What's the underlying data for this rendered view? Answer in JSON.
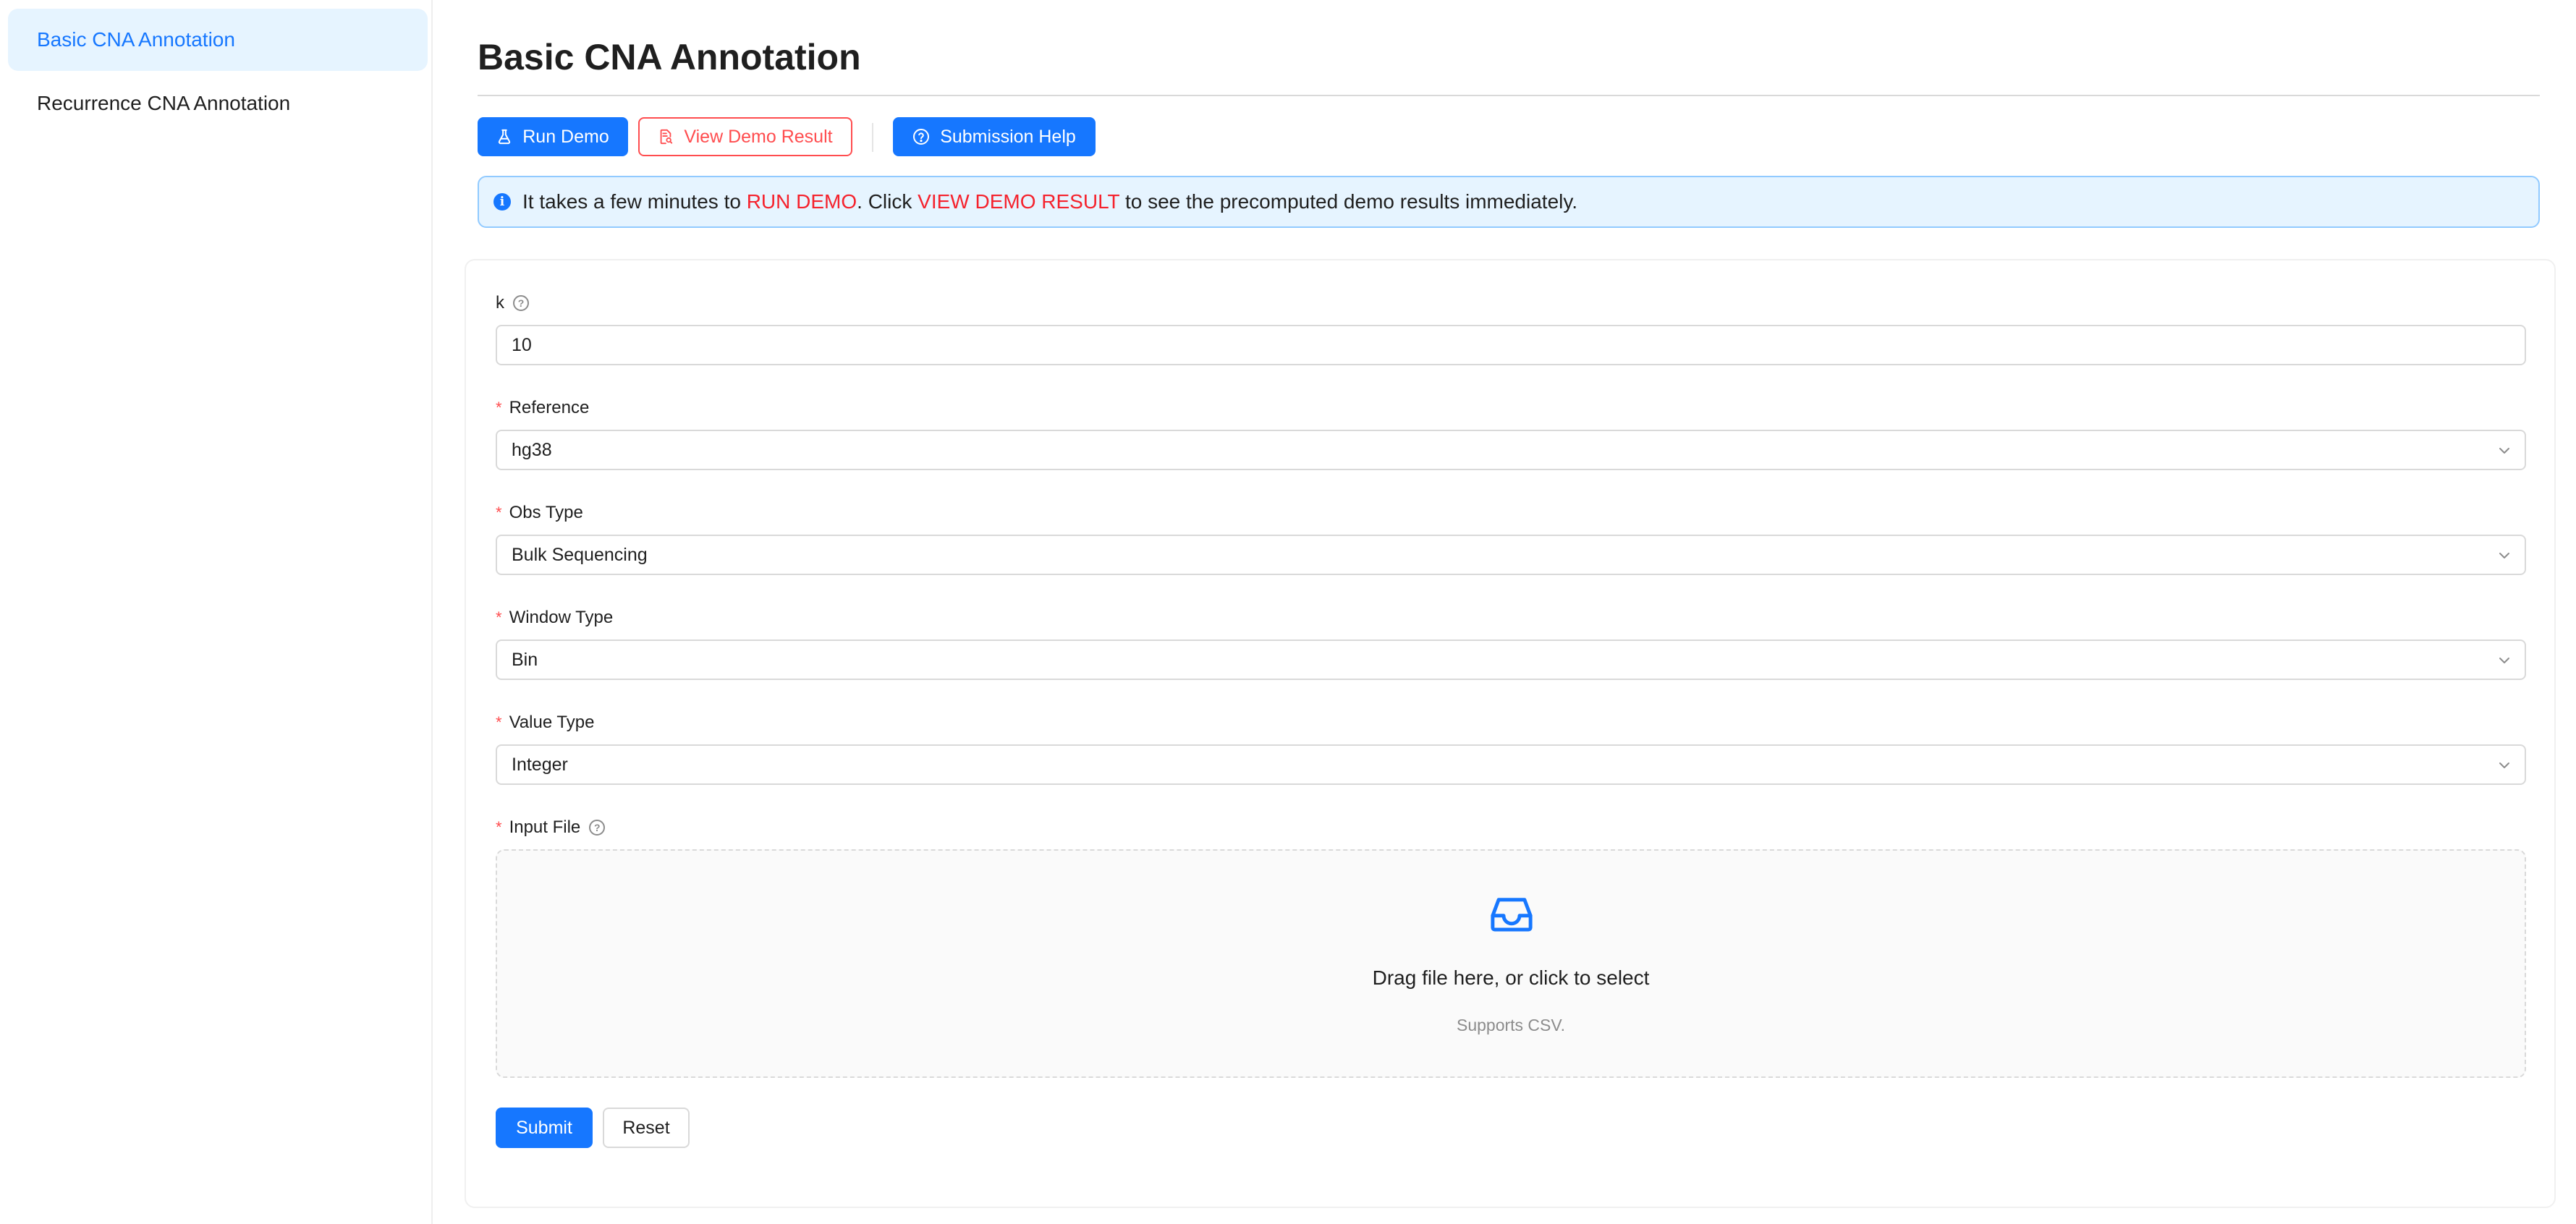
{
  "sidebar": {
    "items": [
      {
        "label": "Basic CNA Annotation",
        "active": true
      },
      {
        "label": "Recurrence CNA Annotation",
        "active": false
      }
    ]
  },
  "main": {
    "title": "Basic CNA Annotation",
    "toolbar": {
      "run_demo": "Run Demo",
      "view_demo_result": "View Demo Result",
      "submission_help": "Submission Help"
    },
    "alert": {
      "prefix": "It takes a few minutes to ",
      "run_demo": "RUN DEMO",
      "middle": ". Click ",
      "view_demo_result": "VIEW DEMO RESULT",
      "suffix": " to see the precomputed demo results immediately."
    }
  },
  "form": {
    "k": {
      "label": "k",
      "value": "10"
    },
    "reference": {
      "label": "Reference",
      "value": "hg38"
    },
    "obs_type": {
      "label": "Obs Type",
      "value": "Bulk Sequencing"
    },
    "window_type": {
      "label": "Window Type",
      "value": "Bin"
    },
    "value_type": {
      "label": "Value Type",
      "value": "Integer"
    },
    "input_file": {
      "label": "Input File",
      "drop_title": "Drag file here, or click to select",
      "drop_hint": "Supports CSV."
    },
    "required_mark": "*",
    "submit": "Submit",
    "reset": "Reset"
  },
  "colors": {
    "primary": "#1677ff",
    "danger": "#ff4d4f",
    "alert_bg": "#e6f4ff",
    "highlight": "#f5222d"
  },
  "icons": {
    "run_demo": "flask-icon",
    "view_demo_result": "file-search-icon",
    "submission_help": "question-circle-icon",
    "alert": "info-circle-icon",
    "dropzone": "inbox-icon",
    "select": "chevron-down-icon"
  }
}
